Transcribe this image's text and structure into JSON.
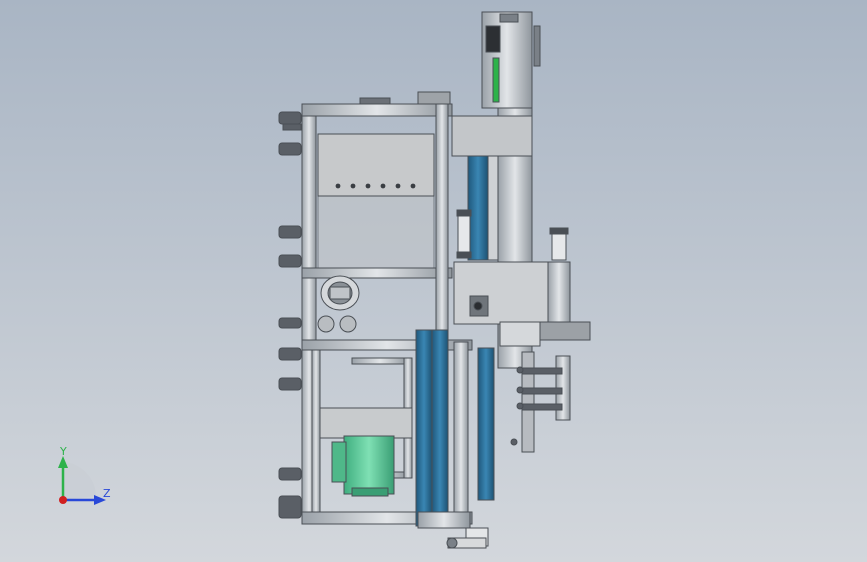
{
  "viewport": {
    "background_top": "#a9b5c4",
    "background_bottom": "#d3d7dc"
  },
  "model": {
    "frame_color": "#c6c9cc",
    "frame_edge": "#4a4f55",
    "belt_color": "#2c6e97",
    "motor_color": "#5fc79a",
    "accent_green": "#2db24a"
  },
  "triad": {
    "y_label": "Y",
    "z_label": "Z",
    "y_color": "#2db24a",
    "z_color": "#2848d8",
    "origin_color": "#d02020"
  }
}
